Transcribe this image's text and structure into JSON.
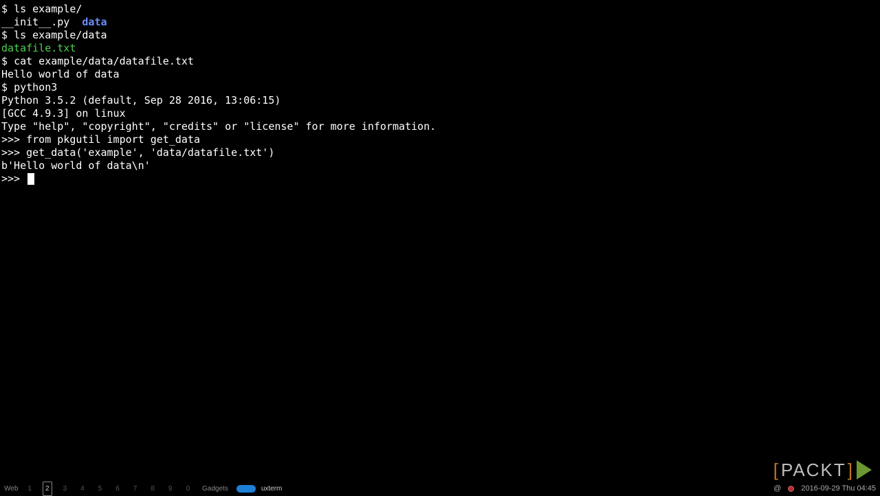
{
  "terminal": {
    "lines": [
      {
        "type": "shell",
        "prompt": "$ ",
        "cmd": "ls example/"
      },
      {
        "type": "ls",
        "items": [
          {
            "text": "__init__.py",
            "class": "file-regular"
          },
          {
            "text": "  ",
            "class": "sep"
          },
          {
            "text": "data",
            "class": "file-dir"
          }
        ]
      },
      {
        "type": "shell",
        "prompt": "$ ",
        "cmd": "ls example/data"
      },
      {
        "type": "ls",
        "items": [
          {
            "text": "datafile.txt",
            "class": "file-exec"
          }
        ]
      },
      {
        "type": "shell",
        "prompt": "$ ",
        "cmd": "cat example/data/datafile.txt"
      },
      {
        "type": "out",
        "text": "Hello world of data"
      },
      {
        "type": "shell",
        "prompt": "$ ",
        "cmd": "python3"
      },
      {
        "type": "out",
        "text": "Python 3.5.2 (default, Sep 28 2016, 13:06:15)"
      },
      {
        "type": "out",
        "text": "[GCC 4.9.3] on linux"
      },
      {
        "type": "out",
        "text": "Type \"help\", \"copyright\", \"credits\" or \"license\" for more information."
      },
      {
        "type": "repl",
        "prompt": ">>> ",
        "cmd": "from pkgutil import get_data"
      },
      {
        "type": "repl",
        "prompt": ">>> ",
        "cmd": "get_data('example', 'data/datafile.txt')"
      },
      {
        "type": "out",
        "text": "b'Hello world of data\\n'"
      },
      {
        "type": "repl_cursor",
        "prompt": ">>> "
      }
    ]
  },
  "taskbar": {
    "web_label": "Web",
    "workspaces": [
      "1",
      "2",
      "3",
      "4",
      "5",
      "6",
      "7",
      "8",
      "9",
      "0"
    ],
    "active_workspace": 1,
    "gadgets_label": "Gadgets",
    "task_name": "uxterm",
    "tray": {
      "at": "@",
      "datetime": "2016-09-29 Thu 04:45"
    }
  },
  "overlay": {
    "packt_open": "[",
    "packt_text": "PACKT",
    "packt_close": "]"
  }
}
